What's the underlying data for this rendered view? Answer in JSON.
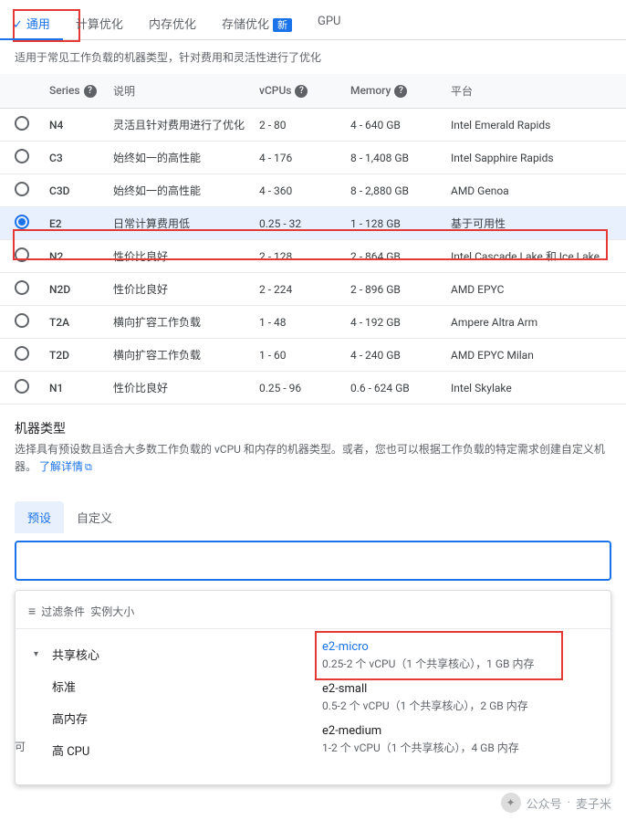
{
  "tabs": {
    "items": [
      {
        "label": "通用",
        "active": true,
        "check": true
      },
      {
        "label": "计算优化"
      },
      {
        "label": "内存优化"
      },
      {
        "label": "存储优化",
        "badge": "新"
      },
      {
        "label": "GPU"
      }
    ],
    "description": "适用于常见工作负载的机器类型，针对费用和灵活性进行了优化"
  },
  "table": {
    "headers": {
      "series": "Series",
      "desc": "说明",
      "vcpus": "vCPUs",
      "memory": "Memory",
      "platform": "平台"
    },
    "rows": [
      {
        "series": "N4",
        "desc": "灵活且针对费用进行了优化",
        "vcpus": "2 - 80",
        "memory": "4 - 640 GB",
        "platform": "Intel Emerald Rapids"
      },
      {
        "series": "C3",
        "desc": "始终如一的高性能",
        "vcpus": "4 - 176",
        "memory": "8 - 1,408 GB",
        "platform": "Intel Sapphire Rapids"
      },
      {
        "series": "C3D",
        "desc": "始终如一的高性能",
        "vcpus": "4 - 360",
        "memory": "8 - 2,880 GB",
        "platform": "AMD Genoa"
      },
      {
        "series": "E2",
        "desc": "日常计算费用低",
        "vcpus": "0.25 - 32",
        "memory": "1 - 128 GB",
        "platform": "基于可用性",
        "selected": true
      },
      {
        "series": "N2",
        "desc": "性价比良好",
        "vcpus": "2 - 128",
        "memory": "2 - 864 GB",
        "platform": "Intel Cascade Lake 和 Ice Lake"
      },
      {
        "series": "N2D",
        "desc": "性价比良好",
        "vcpus": "2 - 224",
        "memory": "2 - 896 GB",
        "platform": "AMD EPYC"
      },
      {
        "series": "T2A",
        "desc": "横向扩容工作负载",
        "vcpus": "1 - 48",
        "memory": "4 - 192 GB",
        "platform": "Ampere Altra Arm"
      },
      {
        "series": "T2D",
        "desc": "横向扩容工作负载",
        "vcpus": "1 - 60",
        "memory": "4 - 240 GB",
        "platform": "AMD EPYC Milan"
      },
      {
        "series": "N1",
        "desc": "性价比良好",
        "vcpus": "0.25 - 96",
        "memory": "0.6 - 624 GB",
        "platform": "Intel Skylake"
      }
    ]
  },
  "machineType": {
    "title": "机器类型",
    "desc": "选择具有预设数且适合大多数工作负载的 vCPU 和内存的机器类型。或者，您也可以根据工作负载的特定需求创建自定义机器。",
    "link": "了解详情"
  },
  "subtabs": {
    "preset": "预设",
    "custom": "自定义"
  },
  "dropdown": {
    "filterLabel": "过滤条件",
    "filterValue": "实例大小",
    "categories": [
      "共享核心",
      "标准",
      "高内存",
      "高 CPU"
    ],
    "options": [
      {
        "name": "e2-micro",
        "desc": "0.25-2 个 vCPU（1 个共享核心），1 GB 内存",
        "highlighted": true
      },
      {
        "name": "e2-small",
        "desc": "0.5-2 个 vCPU（1 个共享核心），2 GB 内存"
      },
      {
        "name": "e2-medium",
        "desc": "1-2 个 vCPU（1 个共享核心），4 GB 内存"
      }
    ]
  },
  "truncatedLabel": "可",
  "footer": {
    "source": "公众号",
    "dot": "·",
    "name": "麦子米"
  }
}
